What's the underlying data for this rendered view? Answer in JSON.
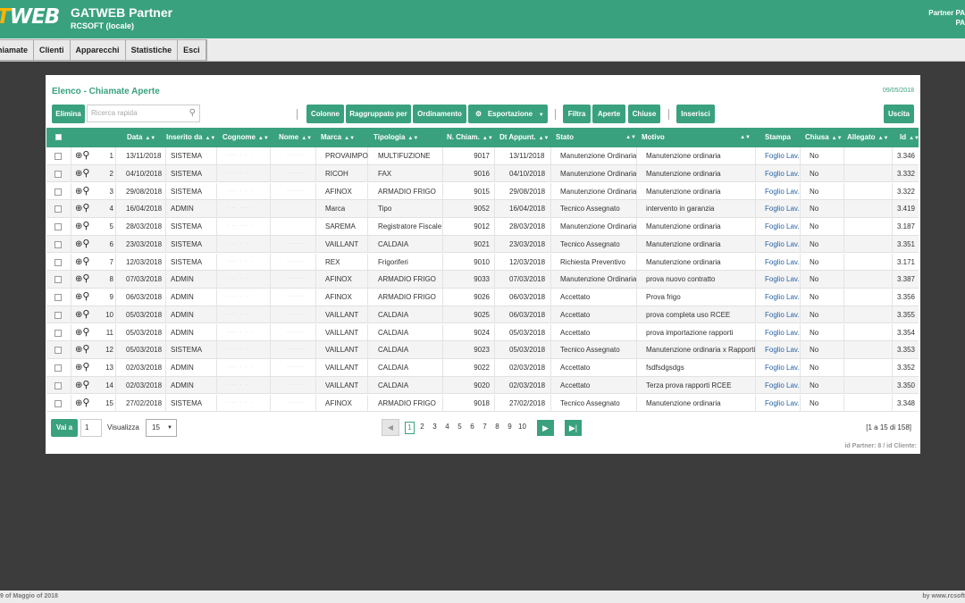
{
  "header": {
    "logo_part1": "T",
    "logo_part2": "WEB",
    "app_title": "GATWEB Partner",
    "app_subtitle": "RCSOFT (locale)",
    "partner_line1": "Partner PA",
    "partner_line2": "PA",
    "brand_color": "#3aa17e"
  },
  "menu": [
    "hiamate",
    "Clienti",
    "Apparecchi",
    "Statistiche",
    "Esci"
  ],
  "panel": {
    "title": "Elenco - Chiamate Aperte",
    "date": "09/05/2018"
  },
  "toolbar": {
    "elimina": "Elimina",
    "search_placeholder": "Ricerca rapida",
    "colonne": "Colonne",
    "raggruppato": "Raggruppato per",
    "ordinamento": "Ordinamento",
    "esportazione": "Esportazione",
    "filtra": "Filtra",
    "aperte": "Aperte",
    "chiuse": "Chiuse",
    "inserisci": "Inserisci",
    "uscita": "Uscita"
  },
  "columns": [
    "Data",
    "Inserito da",
    "Cognome",
    "Nome",
    "Marca",
    "Tipologia",
    "N. Chiam.",
    "Dt Appunt.",
    "Stato",
    "Motivo",
    "Stampa",
    "Chiusa",
    "Allegato",
    "Id"
  ],
  "rows": [
    {
      "n": "1",
      "data": "13/11/2018",
      "ins": "SISTEMA",
      "cog": "···· · · ·",
      "nome": "·······",
      "marca": "PROVAIMPO",
      "tip": "MULTIFUZIONE",
      "nch": "9017",
      "dt": "13/11/2018",
      "stato": "Manutenzione Ordinaria",
      "motivo": "Manutenzione ordinaria",
      "stampa": "Foglio Lav.",
      "chiusa": "No",
      "id": "3.346"
    },
    {
      "n": "2",
      "data": "04/10/2018",
      "ins": "SISTEMA",
      "cog": "···· · · ·",
      "nome": "·······",
      "marca": "RICOH",
      "tip": "FAX",
      "nch": "9016",
      "dt": "04/10/2018",
      "stato": "Manutenzione Ordinaria",
      "motivo": "Manutenzione ordinaria",
      "stampa": "Foglio Lav.",
      "chiusa": "No",
      "id": "3.332"
    },
    {
      "n": "3",
      "data": "29/08/2018",
      "ins": "SISTEMA",
      "cog": "···· · · ·",
      "nome": "·······",
      "marca": "AFINOX",
      "tip": "ARMADIO FRIGO",
      "nch": "9015",
      "dt": "29/08/2018",
      "stato": "Manutenzione Ordinaria",
      "motivo": "Manutenzione ordinaria",
      "stampa": "Foglio Lav.",
      "chiusa": "No",
      "id": "3.322"
    },
    {
      "n": "4",
      "data": "16/04/2018",
      "ins": "ADMIN",
      "cog": "· ·· ··· ·",
      "nome": "",
      "marca": "Marca",
      "tip": "Tipo",
      "nch": "9052",
      "dt": "16/04/2018",
      "stato": "Tecnico Assegnato",
      "motivo": "intervento in garanzia",
      "stampa": "Foglio Lav.",
      "chiusa": "No",
      "id": "3.419"
    },
    {
      "n": "5",
      "data": "28/03/2018",
      "ins": "SISTEMA",
      "cog": "· ·· ··· ·",
      "nome": "",
      "marca": "SAREMA",
      "tip": "Registratore Fiscale",
      "nch": "9012",
      "dt": "28/03/2018",
      "stato": "Manutenzione Ordinaria",
      "motivo": "Manutenzione ordinaria",
      "stampa": "Foglio Lav.",
      "chiusa": "No",
      "id": "3.187"
    },
    {
      "n": "6",
      "data": "23/03/2018",
      "ins": "SISTEMA",
      "cog": "···· · · ·",
      "nome": "·······",
      "marca": "VAILLANT",
      "tip": "CALDAIA",
      "nch": "9021",
      "dt": "23/03/2018",
      "stato": "Tecnico Assegnato",
      "motivo": "Manutenzione ordinaria",
      "stampa": "Foglio Lav.",
      "chiusa": "No",
      "id": "3.351"
    },
    {
      "n": "7",
      "data": "12/03/2018",
      "ins": "SISTEMA",
      "cog": "···· · · ·",
      "nome": "·······",
      "marca": "REX",
      "tip": "Frigoriferi",
      "nch": "9010",
      "dt": "12/03/2018",
      "stato": "Richiesta Preventivo",
      "motivo": "Manutenzione ordinaria",
      "stampa": "Foglio Lav.",
      "chiusa": "No",
      "id": "3.171"
    },
    {
      "n": "8",
      "data": "07/03/2018",
      "ins": "ADMIN",
      "cog": "···· · · ·",
      "nome": "·······",
      "marca": "AFINOX",
      "tip": "ARMADIO FRIGO",
      "nch": "9033",
      "dt": "07/03/2018",
      "stato": "Manutenzione Ordinaria",
      "motivo": "prova nuovo contratto",
      "stampa": "Foglio Lav.",
      "chiusa": "No",
      "id": "3.387"
    },
    {
      "n": "9",
      "data": "06/03/2018",
      "ins": "ADMIN",
      "cog": "···· · · ·",
      "nome": "·······",
      "marca": "AFINOX",
      "tip": "ARMADIO FRIGO",
      "nch": "9026",
      "dt": "06/03/2018",
      "stato": "Accettato",
      "motivo": "Prova frigo",
      "stampa": "Foglio Lav.",
      "chiusa": "No",
      "id": "3.356"
    },
    {
      "n": "10",
      "data": "05/03/2018",
      "ins": "ADMIN",
      "cog": "···· · · ·",
      "nome": "·······",
      "marca": "VAILLANT",
      "tip": "CALDAIA",
      "nch": "9025",
      "dt": "06/03/2018",
      "stato": "Accettato",
      "motivo": "prova completa uso RCEE",
      "stampa": "Foglio Lav.",
      "chiusa": "No",
      "id": "3.355"
    },
    {
      "n": "11",
      "data": "05/03/2018",
      "ins": "ADMIN",
      "cog": "···· · · ·",
      "nome": "·······",
      "marca": "VAILLANT",
      "tip": "CALDAIA",
      "nch": "9024",
      "dt": "05/03/2018",
      "stato": "Accettato",
      "motivo": "prova importazione rapporti",
      "stampa": "Foglio Lav.",
      "chiusa": "No",
      "id": "3.354"
    },
    {
      "n": "12",
      "data": "05/03/2018",
      "ins": "SISTEMA",
      "cog": "···· · · ·",
      "nome": "·······",
      "marca": "VAILLANT",
      "tip": "CALDAIA",
      "nch": "9023",
      "dt": "05/03/2018",
      "stato": "Tecnico Assegnato",
      "motivo": "Manutenzione ordinaria x Rapporti",
      "stampa": "Foglio Lav.",
      "chiusa": "No",
      "id": "3.353"
    },
    {
      "n": "13",
      "data": "02/03/2018",
      "ins": "ADMIN",
      "cog": "···· · · ·",
      "nome": "·······",
      "marca": "VAILLANT",
      "tip": "CALDAIA",
      "nch": "9022",
      "dt": "02/03/2018",
      "stato": "Accettato",
      "motivo": "fsdfsdgsdgs",
      "stampa": "Foglio Lav.",
      "chiusa": "No",
      "id": "3.352"
    },
    {
      "n": "14",
      "data": "02/03/2018",
      "ins": "ADMIN",
      "cog": "···· · · ·",
      "nome": "·······",
      "marca": "VAILLANT",
      "tip": "CALDAIA",
      "nch": "9020",
      "dt": "02/03/2018",
      "stato": "Accettato",
      "motivo": "Terza prova rapporti RCEE",
      "stampa": "Foglio Lav.",
      "chiusa": "No",
      "id": "3.350"
    },
    {
      "n": "15",
      "data": "27/02/2018",
      "ins": "SISTEMA",
      "cog": "···· · · ·",
      "nome": "·······",
      "marca": "AFINOX",
      "tip": "ARMADIO FRIGO",
      "nch": "9018",
      "dt": "27/02/2018",
      "stato": "Tecnico Assegnato",
      "motivo": "Manutenzione ordinaria",
      "stampa": "Foglio Lav.",
      "chiusa": "No",
      "id": "3.348"
    }
  ],
  "pagination": {
    "vai_a": "Vai a",
    "page_value": "1",
    "visualizza": "Visualizza",
    "per_page": "15",
    "pages": [
      "1",
      "2",
      "3",
      "4",
      "5",
      "6",
      "7",
      "8",
      "9",
      "10"
    ],
    "summary": "[1 a 15 di 158]",
    "id_info": "id Partner: 8 / id Cliente:"
  },
  "footer": {
    "left": "9 of Maggio of 2018",
    "right": "by www.rcsoft"
  }
}
